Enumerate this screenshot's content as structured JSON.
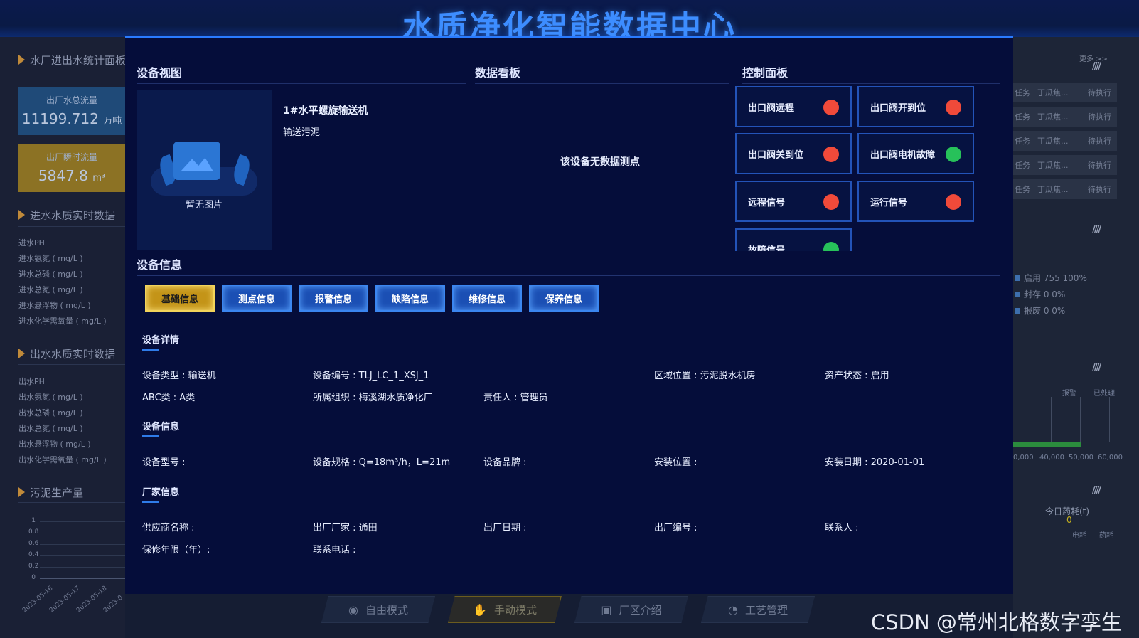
{
  "title": "水质净化智能数据中心",
  "left_panel": {
    "sec1": "水厂进出水统计面板",
    "cards": [
      {
        "label": "出厂水总流量",
        "value": "11199.712",
        "unit": "万吨"
      },
      {
        "label": "出厂瞬时流量",
        "value": "5847.8",
        "unit": "m³"
      }
    ],
    "sec2": "进水水质实时数据",
    "in_items": [
      "进水PH",
      "进水氨氮 ( mg/L )",
      "进水总磷 ( mg/L )",
      "进水总氮 ( mg/L )",
      "进水悬浮物 ( mg/L )",
      "进水化学需氧量 ( mg/L )"
    ],
    "sec3": "出水水质实时数据",
    "out_items": [
      "出水PH",
      "出水氨氮 ( mg/L )",
      "出水总磷 ( mg/L )",
      "出水总氮 ( mg/L )",
      "出水悬浮物 ( mg/L )",
      "出水化学需氧量 ( mg/L )"
    ],
    "sec4": "污泥生产量",
    "y_ticks": [
      "1",
      "0.8",
      "0.6",
      "0.4",
      "0.2",
      "0"
    ],
    "x_dates": [
      "2023-05-16",
      "2023-05-17",
      "2023-05-18",
      "2023-0"
    ]
  },
  "right_panel": {
    "more": "更多 >>",
    "rows": [
      {
        "a": "任务",
        "b": "丁瓜焦...",
        "status": "待执行"
      },
      {
        "a": "任务",
        "b": "丁瓜焦...",
        "status": "待执行"
      },
      {
        "a": "任务",
        "b": "丁瓜焦...",
        "status": "待执行"
      },
      {
        "a": "任务",
        "b": "丁瓜焦...",
        "status": "待执行"
      },
      {
        "a": "任务",
        "b": "丁瓜焦...",
        "status": "待执行"
      }
    ],
    "stats": [
      "启用  755  100%",
      "封存  0  0%",
      "报废  0  0%"
    ],
    "legend": [
      "报警",
      "已处理"
    ],
    "axis": [
      "0,000",
      "40,000",
      "50,000",
      "60,000"
    ],
    "today_label": "今日药耗(t)",
    "today_value": "0",
    "legend2": [
      "电耗",
      "药耗"
    ]
  },
  "modes": [
    {
      "icon": "eye",
      "label": "自由模式"
    },
    {
      "icon": "hand",
      "label": "手动模式"
    },
    {
      "icon": "book",
      "label": "厂区介绍"
    },
    {
      "icon": "pie",
      "label": "工艺管理"
    }
  ],
  "watermark": "CSDN @常州北格数字孪生",
  "modal": {
    "sections": {
      "device_view": "设备视图",
      "data_board": "数据看板",
      "control_panel": "控制面板",
      "device_info": "设备信息"
    },
    "no_image": "暂无图片",
    "device_name": "1#水平螺旋输送机",
    "device_desc": "输送污泥",
    "no_data": "该设备无数据测点",
    "controls": [
      {
        "label": "出口阀远程",
        "status": "red"
      },
      {
        "label": "出口阀开到位",
        "status": "red"
      },
      {
        "label": "出口阀关到位",
        "status": "red"
      },
      {
        "label": "出口阀电机故障",
        "status": "green"
      },
      {
        "label": "远程信号",
        "status": "red"
      },
      {
        "label": "运行信号",
        "status": "red"
      },
      {
        "label": "故障信号",
        "status": "green"
      }
    ],
    "tabs": [
      "基础信息",
      "测点信息",
      "报警信息",
      "缺陷信息",
      "维修信息",
      "保养信息"
    ],
    "active_tab": "基础信息",
    "detail_head": "设备详情",
    "detail": {
      "type": "设备类型 : 输送机",
      "code": "设备编号 : TLJ_LC_1_XSJ_1",
      "area": "区域位置 : 污泥脱水机房",
      "asset": "资产状态 : 启用",
      "abc": "ABC类 : A类",
      "org": "所属组织 : 梅溪湖水质净化厂",
      "owner": "责任人 : 管理员"
    },
    "info_head": "设备信息",
    "info": {
      "model": "设备型号 :",
      "spec": "设备规格 : Q=18m³/h，L=21m",
      "brand": "设备品牌 :",
      "loc": "安装位置 :",
      "date": "安装日期 : 2020-01-01"
    },
    "vendor_head": "厂家信息",
    "vendor": {
      "supplier": "供应商名称 :",
      "maker": "出厂厂家 : 通田",
      "mdate": "出厂日期 :",
      "mno": "出厂编号 :",
      "contact": "联系人 :",
      "warranty": "保修年限（年）:",
      "phone": "联系电话 :"
    }
  },
  "colors": {
    "accent": "#2a7bff",
    "red": "#f04a3a",
    "green": "#27c15a",
    "gold": "#c49418"
  }
}
